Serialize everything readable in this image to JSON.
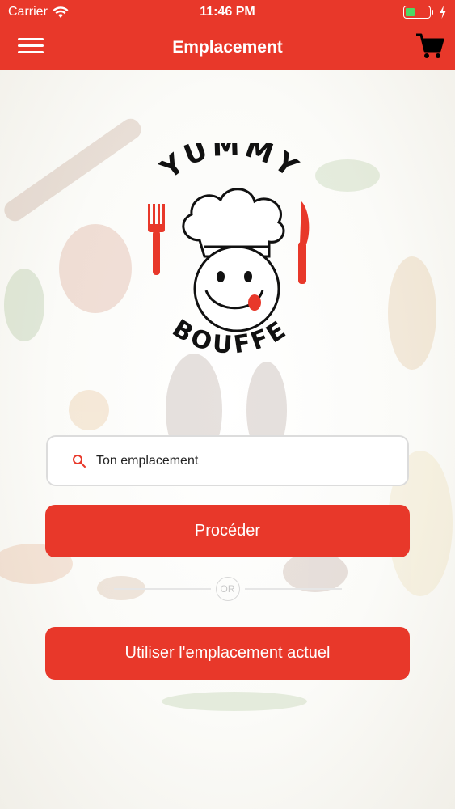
{
  "status_bar": {
    "carrier": "Carrier",
    "time": "11:46 PM",
    "battery_level": 0.4
  },
  "header": {
    "title": "Emplacement",
    "menu_icon": "hamburger-menu-icon",
    "cart_icon": "shopping-cart-icon"
  },
  "logo": {
    "top_text": "YUMMY",
    "bottom_text": "BOUFFE"
  },
  "search": {
    "placeholder": "Ton emplacement",
    "icon": "search-icon"
  },
  "buttons": {
    "proceed": "Procéder",
    "use_current": "Utiliser l'emplacement actuel"
  },
  "divider": {
    "label": "OR"
  },
  "colors": {
    "primary": "#e8382a",
    "battery": "#4cd964"
  }
}
